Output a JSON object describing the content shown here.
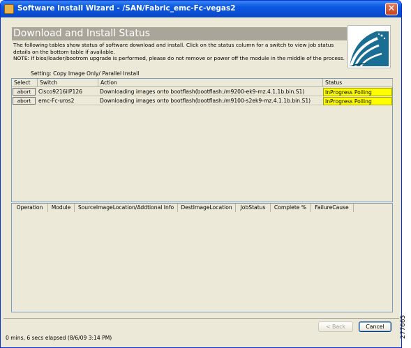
{
  "window": {
    "title": "Software Install Wizard - /SAN/Fabric_emc-Fc-vegas2"
  },
  "header": {
    "title": "Download and Install Status",
    "desc_line1": "The following tables show status of software download and install. Click on the status column for a switch to view job status",
    "desc_line2": "details on the bottom table if available.",
    "desc_line3": "NOTE: If bios/loader/bootrom upgrade is performed, please do not remove or power off the module in the middle of the process."
  },
  "setting": "Setting: Copy Image Only/ Parallel Install",
  "top_table": {
    "columns": [
      "Select",
      "Switch",
      "Action",
      "Status"
    ],
    "rows": [
      {
        "select": "abort",
        "switch": "Cisco9216iIP126",
        "action": "Downloading images onto bootflash(bootflash:/m9200-ek9-mz.4.1.1b.bin.S1)",
        "status": "InProgress Polling"
      },
      {
        "select": "abort",
        "switch": "emc-Fc-uros2",
        "action": "Downloading images onto bootflash(bootflash:/m9100-s2ek9-mz.4.1.1b.bin.S1)",
        "status": "InProgress Polling"
      }
    ]
  },
  "bottom_table": {
    "columns": [
      "Operation",
      "Module",
      "SourceImageLocation/Addtional Info",
      "DestImageLocation",
      "JobStatus",
      "Complete %",
      "FailureCause"
    ]
  },
  "footer": {
    "back_label": "< Back",
    "cancel_label": "Cancel",
    "elapsed": "0 mins, 6 secs elapsed (8/6/09 3:14 PM)"
  },
  "figure_id": "277665",
  "colors": {
    "status_highlight": "#ffff00",
    "titlebar": "#0a4fd6"
  },
  "icons": {
    "window": "app-icon",
    "close": "close-icon",
    "logo": "cisco-wave-logo"
  }
}
